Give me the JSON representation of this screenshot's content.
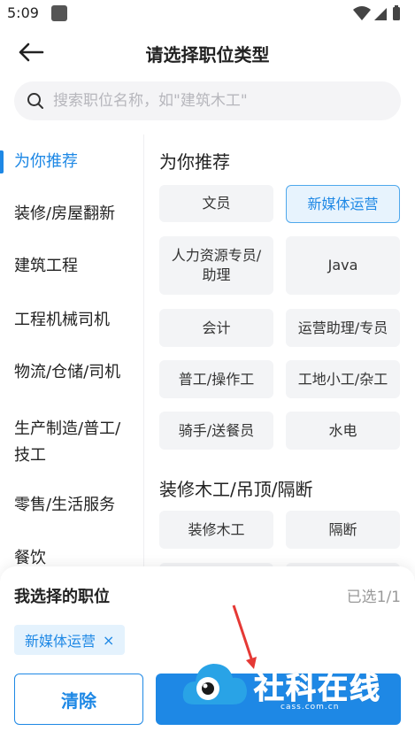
{
  "status_bar": {
    "time": "5:09"
  },
  "header": {
    "title": "请选择职位类型"
  },
  "search": {
    "placeholder": "搜索职位名称，如\"建筑木工\""
  },
  "side_nav": {
    "items": [
      {
        "label": "为你推荐",
        "active": true
      },
      {
        "label": "装修/房屋翻新"
      },
      {
        "label": "建筑工程"
      },
      {
        "label": "工程机械司机"
      },
      {
        "label": "物流/仓储/司机"
      },
      {
        "label": "生产制造/普工/技工"
      },
      {
        "label": "零售/生活服务"
      },
      {
        "label": "餐饮"
      }
    ]
  },
  "content": {
    "sections": [
      {
        "title": "为你推荐",
        "chips": [
          "文员",
          "新媒体运营",
          "人力资源专员/助理",
          "Java",
          "会计",
          "运营助理/专员",
          "普工/操作工",
          "工地小工/杂工",
          "骑手/送餐员",
          "水电"
        ]
      },
      {
        "title": "装修木工/吊顶/隔断",
        "chips": [
          "装修木工",
          "隔断"
        ]
      }
    ],
    "selected_chip": "新媒体运营"
  },
  "bottom_panel": {
    "title": "我选择的职位",
    "count": "已选1/1",
    "selected_tag": "新媒体运营",
    "tag_close": "×",
    "clear_label": "清除"
  },
  "watermark": {
    "text": "社科在线",
    "sub": "cass.com.cn"
  },
  "colors": {
    "accent": "#1e88e5",
    "chip_bg": "#f3f4f6",
    "selected_bg": "#e7f3fd"
  }
}
